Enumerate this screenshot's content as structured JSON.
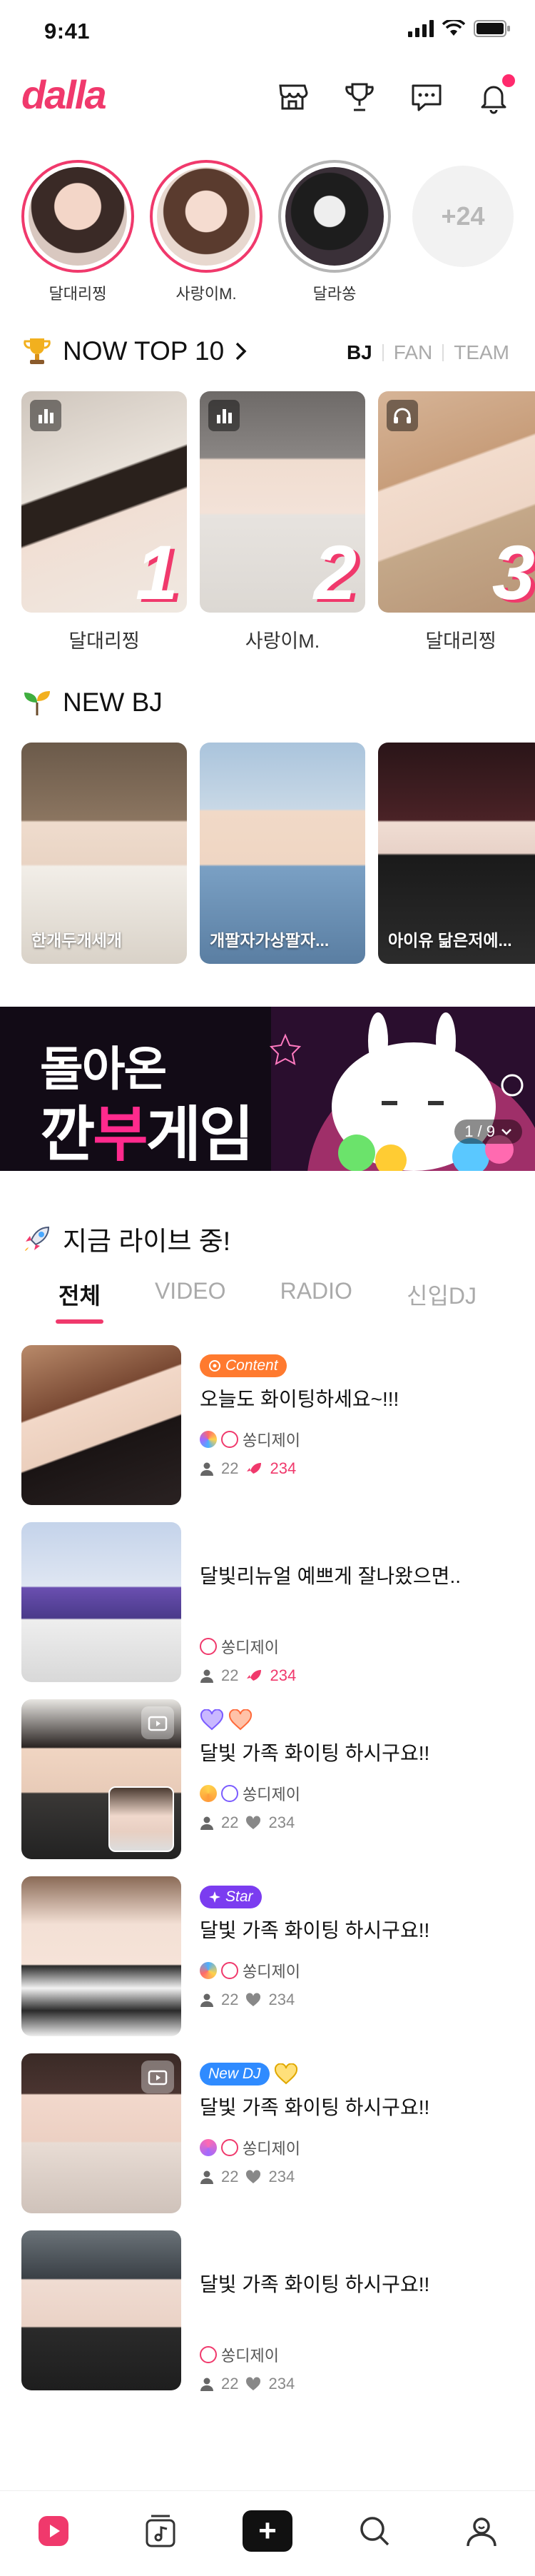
{
  "status": {
    "time": "9:41"
  },
  "header": {
    "logo": "dalla",
    "icons": [
      "store-icon",
      "trophy-icon",
      "message-icon",
      "bell-icon"
    ]
  },
  "stories": {
    "items": [
      {
        "name": "달대리찡",
        "ring": "live"
      },
      {
        "name": "사랑이M.",
        "ring": "live"
      },
      {
        "name": "달라쏭",
        "ring": "off"
      }
    ],
    "more_label": "+24"
  },
  "top10": {
    "title": "NOW TOP 10",
    "filters": [
      "BJ",
      "FAN",
      "TEAM"
    ],
    "active_filter": "BJ",
    "cards": [
      {
        "rank": "1",
        "name": "달대리찡",
        "badge": "chart-icon"
      },
      {
        "rank": "2",
        "name": "사랑이M.",
        "badge": "chart-icon"
      },
      {
        "rank": "3",
        "name": "달대리찡",
        "badge": "headphones-icon"
      }
    ]
  },
  "newbj": {
    "title": "NEW BJ",
    "cards": [
      {
        "name": "한개두개세개"
      },
      {
        "name": "개팔자가상팔자..."
      },
      {
        "name": "아이유 닮은저에..."
      }
    ]
  },
  "banner": {
    "line1": "돌아온",
    "line2_a": "깐",
    "line2_b": "부",
    "line2_c": "게임",
    "page": "1 / 9"
  },
  "live": {
    "title": "지금 라이브 중!",
    "tabs": [
      "전체",
      "VIDEO",
      "RADIO",
      "신입DJ"
    ],
    "active_tab": "전체",
    "items": [
      {
        "tag": "Content",
        "title": "오늘도 화이팅하세요~!!!",
        "host": "쏭디제이",
        "listeners": "22",
        "likes": "234",
        "hot": true
      },
      {
        "tag": "",
        "title": "달빛리뉴얼 예쁘게 잘나왔으면..",
        "host": "쏭디제이",
        "listeners": "22",
        "likes": "234",
        "hot": true
      },
      {
        "tag": "",
        "title": "달빛 가족 화이팅 하시구요!!",
        "host": "쏭디제이",
        "listeners": "22",
        "likes": "234",
        "hot": false
      },
      {
        "tag": "Star",
        "title": "달빛 가족 화이팅 하시구요!!",
        "host": "쏭디제이",
        "listeners": "22",
        "likes": "234",
        "hot": false
      },
      {
        "tag": "New DJ",
        "title": "달빛 가족 화이팅 하시구요!!",
        "host": "쏭디제이",
        "listeners": "22",
        "likes": "234",
        "hot": false
      },
      {
        "tag": "",
        "title": "달빛 가족 화이팅 하시구요!!",
        "host": "쏭디제이",
        "listeners": "22",
        "likes": "234",
        "hot": false
      }
    ]
  },
  "colors": {
    "brand": "#f0396c",
    "content_tag": "#ff7a2f",
    "star_tag": "#7b3cf0",
    "newdj_tag": "#2f8bff"
  }
}
